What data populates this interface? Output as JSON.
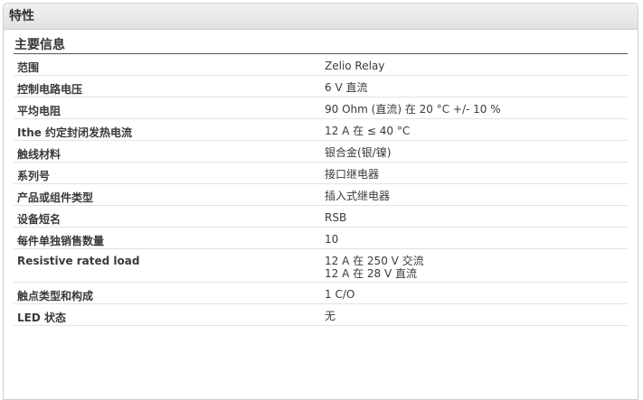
{
  "panel": {
    "title": "特性"
  },
  "section": {
    "title": "主要信息"
  },
  "rows": [
    {
      "label": "范围",
      "values": [
        "Zelio Relay"
      ]
    },
    {
      "label": "控制电路电压",
      "values": [
        "6 V 直流"
      ]
    },
    {
      "label": "平均电阻",
      "values": [
        "90 Ohm (直流) 在 20 °C +/- 10 %"
      ]
    },
    {
      "label": "Ithe 约定封闭发热电流",
      "values": [
        "12 A 在 ≤ 40 °C"
      ]
    },
    {
      "label": "触线材料",
      "values": [
        "银合金(银/镍)"
      ]
    },
    {
      "label": "系列号",
      "values": [
        "接口继电器"
      ]
    },
    {
      "label": "产品或组件类型",
      "values": [
        "插入式继电器"
      ]
    },
    {
      "label": "设备短名",
      "values": [
        "RSB"
      ]
    },
    {
      "label": "每件单独销售数量",
      "values": [
        "10"
      ]
    },
    {
      "label": "Resistive rated load",
      "values": [
        "12 A 在 250 V 交流",
        "12 A 在 28 V 直流"
      ]
    },
    {
      "label": "触点类型和构成",
      "values": [
        "1 C/O"
      ]
    },
    {
      "label": "LED 状态",
      "values": [
        "无"
      ]
    }
  ]
}
